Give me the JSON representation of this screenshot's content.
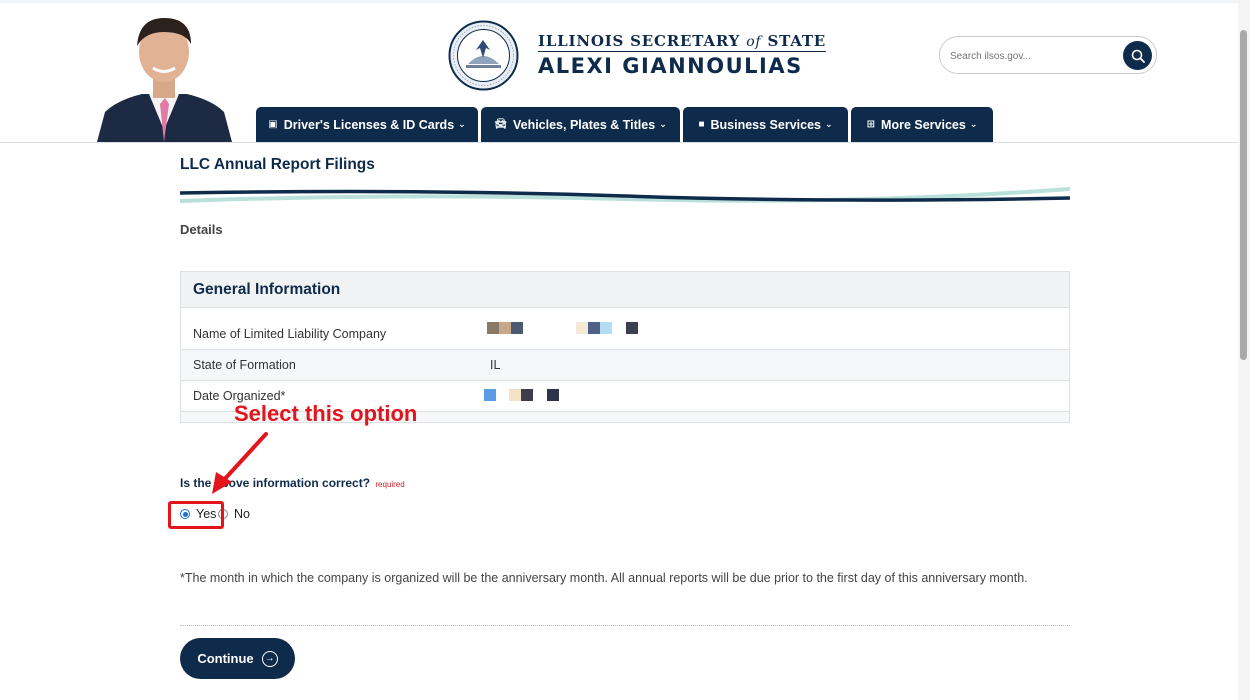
{
  "header": {
    "title_line1_a": "ILLINOIS SECRETARY",
    "title_line1_b": "of",
    "title_line1_c": "STATE",
    "title_line2": "ALEXI GIANNOULIAS",
    "search_placeholder": "Search ilsos.gov...",
    "nav": [
      {
        "label": "Driver's Licenses & ID Cards",
        "icon": "id-card-icon"
      },
      {
        "label": "Vehicles, Plates & Titles",
        "icon": "car-icon"
      },
      {
        "label": "Business Services",
        "icon": "briefcase-icon"
      },
      {
        "label": "More Services",
        "icon": "grid-icon"
      }
    ]
  },
  "main": {
    "page_title": "LLC Annual Report Filings",
    "section_label": "Details",
    "card": {
      "title": "General Information",
      "rows": [
        {
          "label": "Name of Limited Liability Company",
          "value": ""
        },
        {
          "label": "State of Formation",
          "value": "IL"
        },
        {
          "label": "Date Organized*",
          "value": ""
        }
      ]
    },
    "question": "Is the above information correct?",
    "required_text": "required",
    "options": [
      {
        "label": "Yes",
        "checked": true
      },
      {
        "label": "No",
        "checked": false
      }
    ],
    "note": "*The month in which the company is organized will be the anniversary month. All annual reports will be due prior to the first day of this anniversary month.",
    "continue_label": "Continue"
  },
  "annotation": {
    "text": "Select this option",
    "color": "#e3141b"
  },
  "colors": {
    "brand_navy": "#0f2b4c",
    "accent_teal": "#b9e0d9",
    "radio_blue": "#1a6fd8"
  }
}
